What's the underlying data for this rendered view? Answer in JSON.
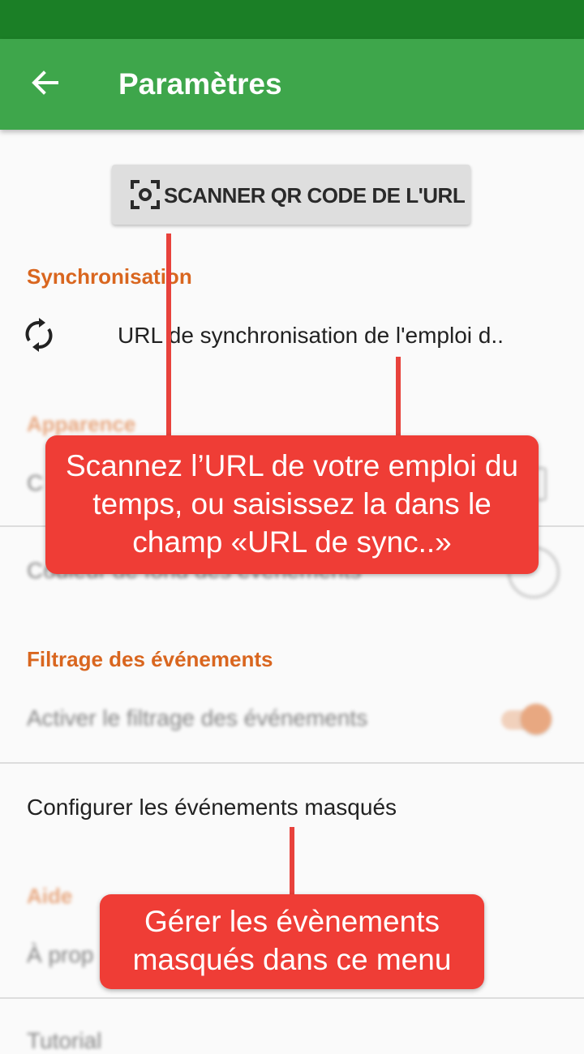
{
  "appbar": {
    "title": "Paramètres",
    "back_icon": "arrow-left-icon"
  },
  "scan_button": {
    "label": "SCANNER QR CODE DE L'URL",
    "icon": "qr-scan-icon"
  },
  "sections": {
    "sync": {
      "header": "Synchronisation",
      "url_label": "URL de synchronisation de l'emploi d..",
      "icon": "sync-icon"
    },
    "appearance": {
      "header": "Apparence",
      "item1": "C",
      "item2": "Couleur de fond des événements"
    },
    "filtering": {
      "header": "Filtrage des événements",
      "toggle_label": "Activer le filtrage des événements",
      "toggle_on": true,
      "configure_label": "Configurer les événements masqués"
    },
    "help": {
      "header": "Aide",
      "about_label": "À prop",
      "tutorial_label": "Tutorial"
    }
  },
  "callouts": {
    "top": "Scannez l’URL de votre emploi du temps, ou saisissez la dans le champ «URL de sync..»",
    "bottom": "Gérer les évènements masqués dans ce menu"
  },
  "colors": {
    "status_bar": "#1b7f26",
    "app_bar": "#3ea64b",
    "accent": "#d9661f",
    "callout": "#ef3d36"
  }
}
